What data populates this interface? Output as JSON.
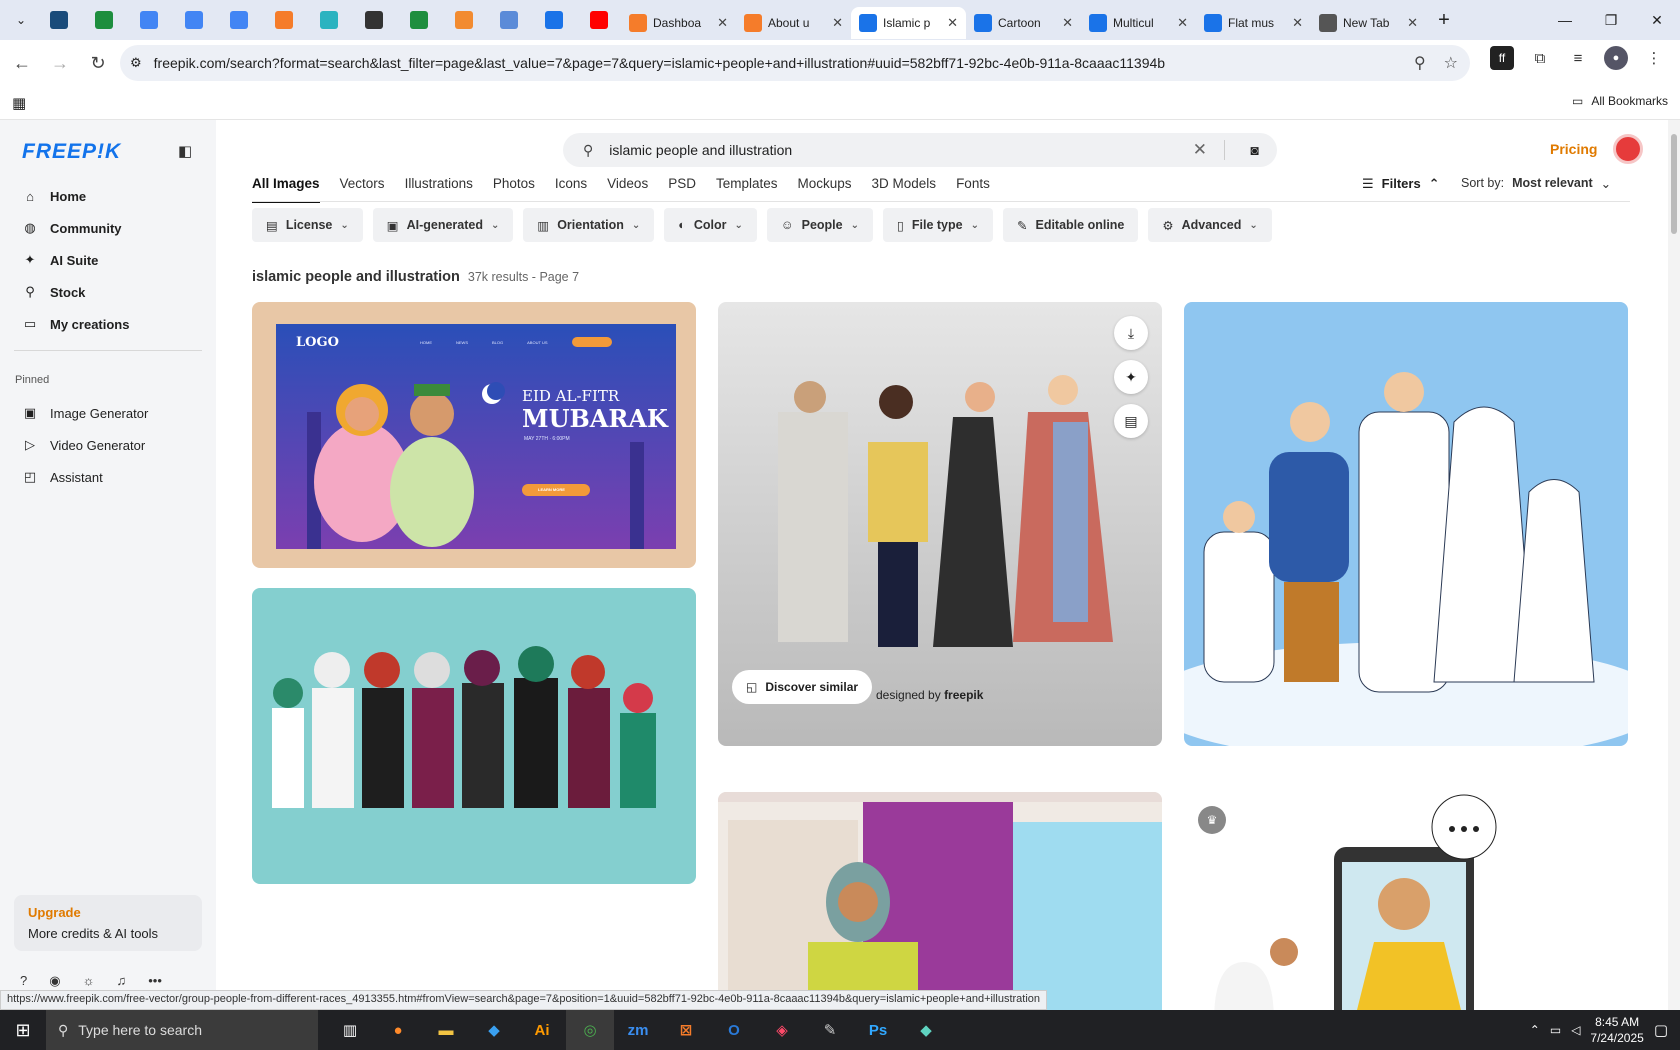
{
  "browser": {
    "pinned_tabs": [
      "vpn-icon",
      "sheets-icon",
      "docs-icon",
      "docs-icon",
      "docs-icon",
      "xampp-icon",
      "app-icon",
      "chatgpt-icon",
      "sheets-icon",
      "pie-icon",
      "grid-icon",
      "forms-icon",
      "youtube-icon"
    ],
    "tabs": [
      {
        "title": "Dashboa",
        "active": false
      },
      {
        "title": "About u",
        "active": false
      },
      {
        "title": "Islamic p",
        "active": true
      },
      {
        "title": "Cartoon",
        "active": false
      },
      {
        "title": "Multicul",
        "active": false
      },
      {
        "title": "Flat mus",
        "active": false
      },
      {
        "title": "New Tab",
        "active": false
      }
    ],
    "url": "freepik.com/search?format=search&last_filter=page&last_value=7&page=7&query=islamic+people+and+illustration#uuid=582bff71-92bc-4e0b-911a-8caaac11394b",
    "all_bookmarks": "All Bookmarks"
  },
  "sidebar": {
    "logo": "FREEP!K",
    "nav": [
      {
        "label": "Home",
        "icon": "home-icon",
        "glyph": "⌂"
      },
      {
        "label": "Community",
        "icon": "globe-icon",
        "glyph": "◍"
      },
      {
        "label": "AI Suite",
        "icon": "sparkle-icon",
        "glyph": "✦"
      },
      {
        "label": "Stock",
        "icon": "search-icon",
        "glyph": "⚲"
      },
      {
        "label": "My creations",
        "icon": "folder-icon",
        "glyph": "▭"
      }
    ],
    "pinned_label": "Pinned",
    "pinned": [
      {
        "label": "Image Generator",
        "icon": "image-icon",
        "glyph": "▣"
      },
      {
        "label": "Video Generator",
        "icon": "video-icon",
        "glyph": "▷"
      },
      {
        "label": "Assistant",
        "icon": "assistant-icon",
        "glyph": "◰"
      }
    ],
    "upgrade_title": "Upgrade",
    "upgrade_text": "More credits & AI tools"
  },
  "search": {
    "value": "islamic people and illustration"
  },
  "header": {
    "pricing": "Pricing"
  },
  "categories": [
    "All Images",
    "Vectors",
    "Illustrations",
    "Photos",
    "Icons",
    "Videos",
    "PSD",
    "Templates",
    "Mockups",
    "3D Models",
    "Fonts"
  ],
  "filters_label": "Filters",
  "sort": {
    "label": "Sort by:",
    "value": "Most relevant"
  },
  "chips": [
    "License",
    "AI-generated",
    "Orientation",
    "Color",
    "People",
    "File type",
    "Editable online",
    "Advanced"
  ],
  "results": {
    "query": "islamic people and illustration",
    "count": "37k results - Page 7"
  },
  "card_banner": {
    "logo": "LOGO",
    "nav": [
      "HOME",
      "NEWS",
      "BLOG",
      "ABOUT US"
    ],
    "title1": "EID AL-FITR",
    "title2": "MUBARAK",
    "date": "MAY 27TH · 6:00PM",
    "cta": "LEARN MORE"
  },
  "featured": {
    "discover": "Discover similar",
    "designed": "designed by",
    "brand": "freepik"
  },
  "status_url": "https://www.freepik.com/free-vector/group-people-from-different-races_4913355.htm#fromView=search&page=7&position=1&uuid=582bff71-92bc-4e0b-911a-8caaac11394b&query=islamic+people+and+illustration",
  "taskbar": {
    "search_placeholder": "Type here to search",
    "time": "8:45 AM",
    "date": "7/24/2025"
  }
}
